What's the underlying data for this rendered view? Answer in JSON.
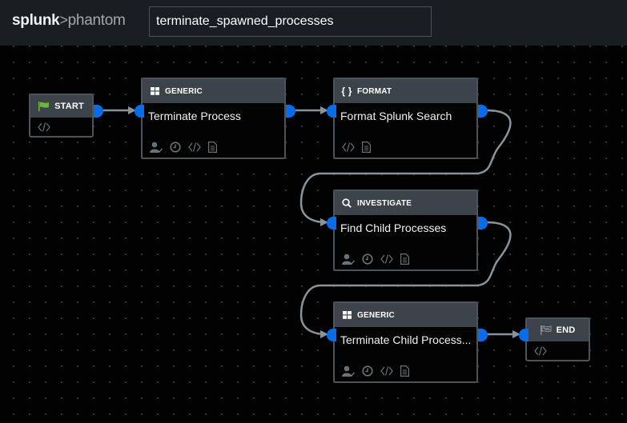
{
  "header": {
    "logo_primary": "splunk",
    "logo_separator": ">",
    "logo_secondary": "phantom",
    "playbook_name": "terminate_spawned_processes"
  },
  "colors": {
    "port": "#0a6ce8",
    "edge": "#8a9399",
    "node_header": "#3c434a",
    "node_border": "#4c545a",
    "start_flag": "#6db33f"
  },
  "nodes": {
    "start": {
      "label": "START",
      "icon": "flag-icon",
      "actions": [
        "code-icon"
      ]
    },
    "terminate_process": {
      "type": "GENERIC",
      "icon": "grid-icon",
      "title": "Terminate Process",
      "actions": [
        "approver-icon",
        "clock-icon",
        "code-icon",
        "document-icon"
      ]
    },
    "format_splunk_search": {
      "type": "FORMAT",
      "icon": "braces-icon",
      "title": "Format Splunk Search",
      "actions": [
        "code-icon",
        "document-icon"
      ]
    },
    "find_child_processes": {
      "type": "INVESTIGATE",
      "icon": "search-icon",
      "title": "Find Child Processes",
      "actions": [
        "approver-icon",
        "clock-icon",
        "code-icon",
        "document-icon"
      ]
    },
    "terminate_child_processes": {
      "type": "GENERIC",
      "icon": "grid-icon",
      "title": "Terminate Child Process...",
      "actions": [
        "approver-icon",
        "clock-icon",
        "code-icon",
        "document-icon"
      ]
    },
    "end": {
      "label": "END",
      "icon": "checkered-flag-icon",
      "actions": [
        "code-icon"
      ]
    }
  },
  "edges": [
    {
      "from": "START",
      "to": "Terminate Process"
    },
    {
      "from": "Terminate Process",
      "to": "Format Splunk Search"
    },
    {
      "from": "Format Splunk Search",
      "to": "Find Child Processes"
    },
    {
      "from": "Find Child Processes",
      "to": "Terminate Child Process..."
    },
    {
      "from": "Terminate Child Process...",
      "to": "END"
    }
  ]
}
